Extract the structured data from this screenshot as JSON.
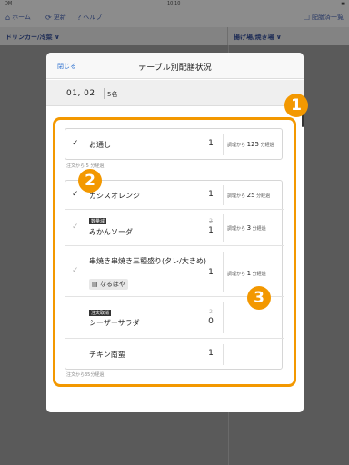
{
  "status_bar": {
    "carrier": "DM",
    "time": "10:10",
    "battery": "■"
  },
  "toolbar": {
    "home_label": "ホーム",
    "update_label": "更新",
    "help_label": "ヘルプ",
    "list_label": "配膳済一覧"
  },
  "sections": {
    "left": "ドリンカー/冷菜 ∨",
    "right": "揚げ場/焼き場 ∨"
  },
  "modal": {
    "close_label": "閉じる",
    "title": "テーブル別配膳状況",
    "table_id": "01, 02",
    "guests": "5名"
  },
  "card1": {
    "check": "✓",
    "name": "お通し",
    "qty": "1",
    "elapsed_prefix": "調理から",
    "elapsed_num": "125",
    "elapsed_suffix": "分経過"
  },
  "note1": "注文から 5 分経過",
  "card2": {
    "rows": [
      {
        "check": "✓",
        "badge": "",
        "name": "カシスオレンジ",
        "qty_old": "",
        "qty": "1",
        "elapsed_prefix": "調理から",
        "elapsed_num": "25",
        "elapsed_suffix": "分経過",
        "person": ""
      },
      {
        "check": "✓",
        "badge": "数量減",
        "name": "みかんソーダ",
        "qty_old": "2",
        "qty": "1",
        "elapsed_prefix": "調理から",
        "elapsed_num": "3",
        "elapsed_suffix": "分経過",
        "person": ""
      },
      {
        "check": "✓",
        "badge": "",
        "name": "串焼き串焼き三種盛り(タレ/大きめ)",
        "qty_old": "",
        "qty": "1",
        "elapsed_prefix": "調理から",
        "elapsed_num": "1",
        "elapsed_suffix": "分経過",
        "person": "なるはや"
      },
      {
        "check": "",
        "badge": "注文取消",
        "name": "シーザーサラダ",
        "qty_old": "2",
        "qty": "0",
        "elapsed_prefix": "",
        "elapsed_num": "",
        "elapsed_suffix": "",
        "person": ""
      },
      {
        "check": "",
        "badge": "",
        "name": "チキン南蛮",
        "qty_old": "",
        "qty": "1",
        "elapsed_prefix": "",
        "elapsed_num": "",
        "elapsed_suffix": "",
        "person": ""
      }
    ]
  },
  "note2": "注文から35分経過",
  "annotations": {
    "c1": "1",
    "c2": "2",
    "c3": "3"
  },
  "colors": {
    "accent": "#f39800",
    "link": "#2b6fcf"
  }
}
